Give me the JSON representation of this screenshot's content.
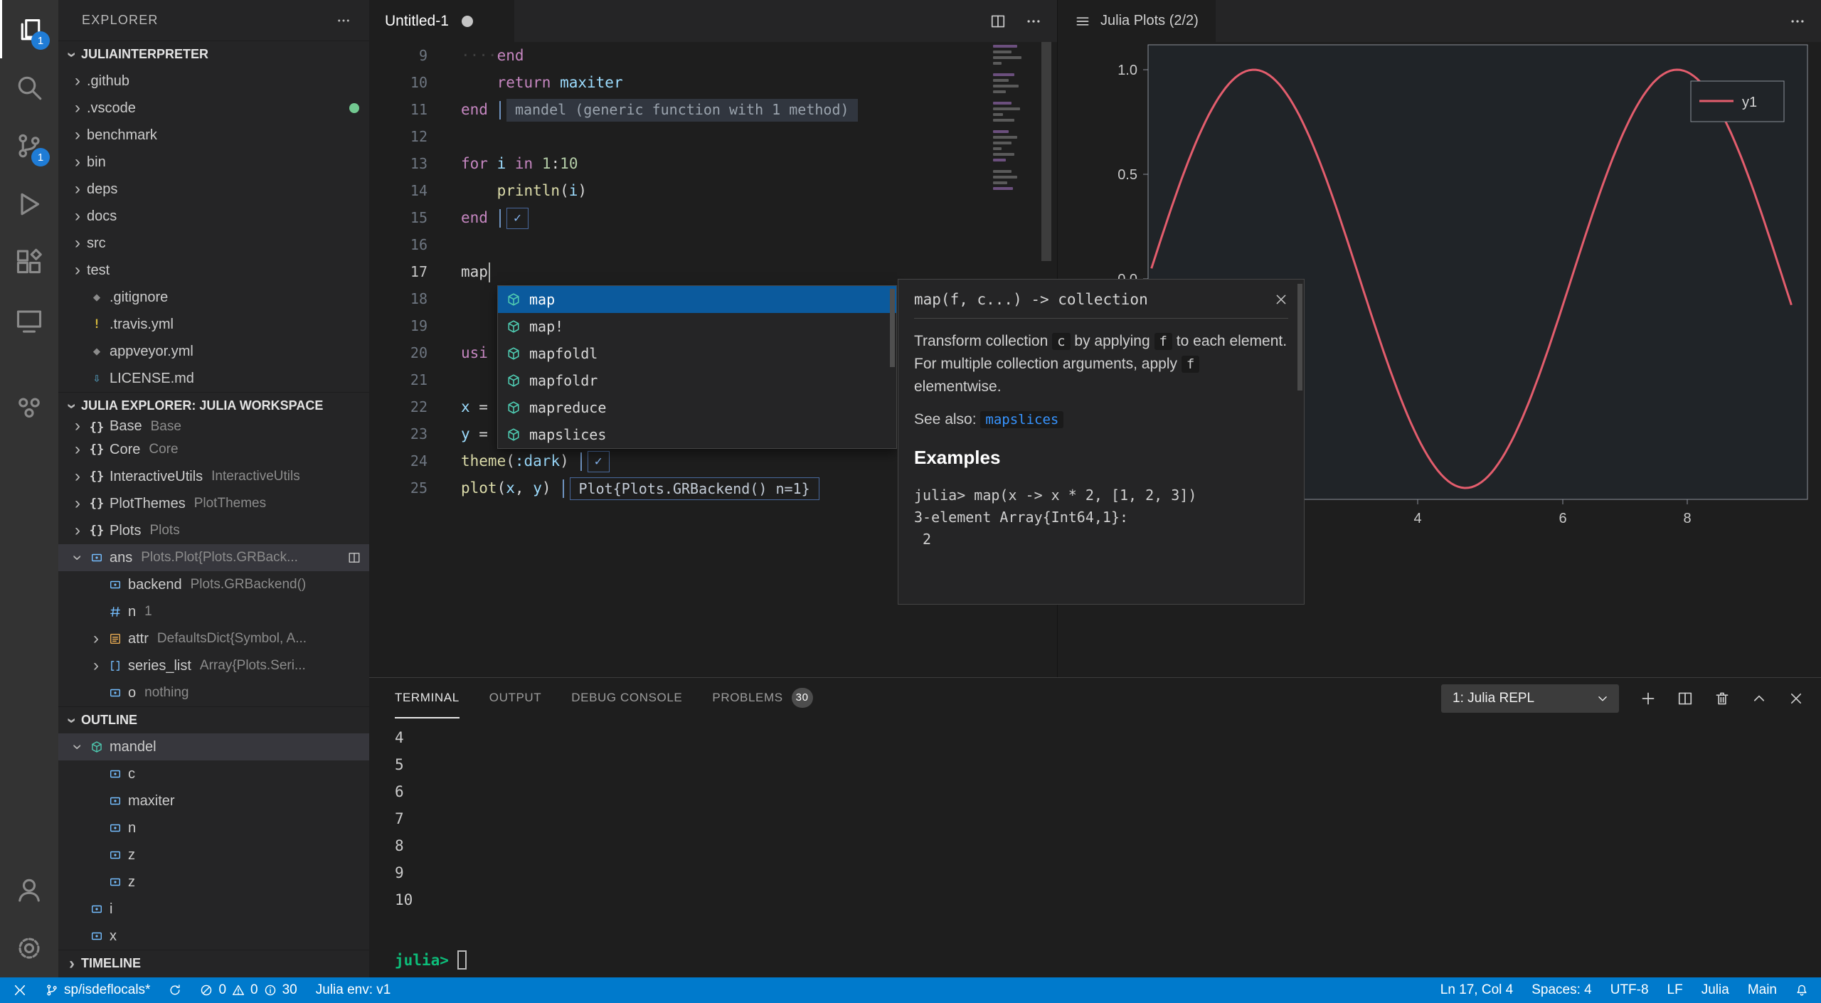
{
  "colors": {
    "status_bar_bg": "#007acc",
    "curve": "#e35d6d",
    "badge_blue": "#1f7cd6",
    "prompt_green": "#0dbc79"
  },
  "activity_bar": {
    "badges": {
      "explorer": "1",
      "scm": "1"
    }
  },
  "sidebar": {
    "title": "EXPLORER",
    "sections": [
      {
        "label": "JULIAINTERPRETER",
        "expanded": true,
        "items": [
          {
            "chev": "right",
            "label": ".github"
          },
          {
            "chev": "right",
            "label": ".vscode",
            "git_dot": true
          },
          {
            "chev": "right",
            "label": "benchmark"
          },
          {
            "chev": "right",
            "label": "bin"
          },
          {
            "chev": "right",
            "label": "deps"
          },
          {
            "chev": "right",
            "label": "docs"
          },
          {
            "chev": "right",
            "label": "src"
          },
          {
            "chev": "right",
            "label": "test"
          },
          {
            "icon": {
              "name": "gitignore-file-icon",
              "text": "◆",
              "color": "#8b8b8b"
            },
            "label": ".gitignore"
          },
          {
            "icon": {
              "name": "travis-file-icon",
              "text": "!",
              "color": "#d7ba3d"
            },
            "label": ".travis.yml"
          },
          {
            "icon": {
              "name": "appveyor-file-icon",
              "text": "◆",
              "color": "#8b8b8b"
            },
            "label": "appveyor.yml"
          },
          {
            "icon": {
              "name": "markdown-file-icon",
              "text": "⇩",
              "color": "#519aba"
            },
            "label": "LICENSE.md"
          }
        ]
      },
      {
        "label": "JULIA EXPLORER: JULIA WORKSPACE",
        "expanded": true,
        "items": [
          {
            "chev": "right",
            "clip": true,
            "icon": {
              "name": "namespace-icon",
              "text": "{}",
              "color": "#d4d4d4"
            },
            "label": "Base",
            "detail": "Base"
          },
          {
            "chev": "right",
            "icon": {
              "name": "namespace-icon",
              "text": "{}",
              "color": "#d4d4d4"
            },
            "label": "Core",
            "detail": "Core"
          },
          {
            "chev": "right",
            "icon": {
              "name": "namespace-icon",
              "text": "{}",
              "color": "#d4d4d4"
            },
            "label": "InteractiveUtils",
            "detail": "InteractiveUtils"
          },
          {
            "chev": "right",
            "icon": {
              "name": "namespace-icon",
              "text": "{}",
              "color": "#d4d4d4"
            },
            "label": "PlotThemes",
            "detail": "PlotThemes"
          },
          {
            "chev": "right",
            "icon": {
              "name": "namespace-icon",
              "text": "{}",
              "color": "#d4d4d4"
            },
            "label": "Plots",
            "detail": "Plots"
          },
          {
            "chev": "down",
            "icon": {
              "name": "variable-icon",
              "svg": "var",
              "color": "#75beff"
            },
            "label": "ans",
            "detail": "Plots.Plot{Plots.GRBack...",
            "selected": true,
            "trailing": true
          },
          {
            "indent": 2,
            "icon": {
              "name": "variable-icon",
              "svg": "var",
              "color": "#75beff"
            },
            "label": "backend",
            "detail": "Plots.GRBackend()"
          },
          {
            "indent": 2,
            "icon": {
              "name": "number-icon",
              "svg": "hash",
              "color": "#75beff"
            },
            "label": "n",
            "detail": "1"
          },
          {
            "indent": 2,
            "chev": "right",
            "icon": {
              "name": "attr-icon",
              "svg": "attr",
              "color": "#e8ab53"
            },
            "label": "attr",
            "detail": "DefaultsDict{Symbol, A..."
          },
          {
            "indent": 2,
            "chev": "right",
            "icon": {
              "name": "array-icon",
              "svg": "list",
              "color": "#75beff"
            },
            "label": "series_list",
            "detail": "Array{Plots.Seri..."
          },
          {
            "indent": 2,
            "icon": {
              "name": "variable-icon",
              "svg": "var",
              "color": "#75beff"
            },
            "label": "o",
            "detail": "nothing"
          }
        ]
      },
      {
        "label": "OUTLINE",
        "expanded": true,
        "items": [
          {
            "chev": "down",
            "icon": {
              "name": "method-icon",
              "svg": "cube",
              "color": "#4ec9b0"
            },
            "label": "mandel",
            "selected": true
          },
          {
            "indent": 2,
            "icon": {
              "name": "variable-icon",
              "svg": "var",
              "color": "#75beff"
            },
            "label": "c"
          },
          {
            "indent": 2,
            "icon": {
              "name": "variable-icon",
              "svg": "var",
              "color": "#75beff"
            },
            "label": "maxiter"
          },
          {
            "indent": 2,
            "icon": {
              "name": "variable-icon",
              "svg": "var",
              "color": "#75beff"
            },
            "label": "n"
          },
          {
            "indent": 2,
            "icon": {
              "name": "variable-icon",
              "svg": "var",
              "color": "#75beff"
            },
            "label": "z"
          },
          {
            "indent": 2,
            "icon": {
              "name": "variable-icon",
              "svg": "var",
              "color": "#75beff"
            },
            "label": "z"
          },
          {
            "icon": {
              "name": "variable-icon",
              "svg": "var",
              "color": "#75beff"
            },
            "label": "i"
          },
          {
            "icon": {
              "name": "variable-icon",
              "svg": "var",
              "color": "#75beff"
            },
            "label": "x"
          }
        ]
      },
      {
        "label": "TIMELINE",
        "expanded": false,
        "items": []
      }
    ]
  },
  "editor": {
    "tab": {
      "title": "Untitled-1",
      "dirty": true
    },
    "lines": [
      {
        "num": 9,
        "segs": [
          {
            "c": "ws",
            "t": "····"
          },
          {
            "c": "kw",
            "t": "end"
          }
        ]
      },
      {
        "num": 10,
        "segs": [
          {
            "c": "p",
            "t": "    "
          },
          {
            "c": "kw",
            "t": "return"
          },
          {
            "c": "p",
            "t": " "
          },
          {
            "c": "v",
            "t": "maxiter"
          }
        ]
      },
      {
        "num": 11,
        "segs": [
          {
            "c": "kw",
            "t": "end"
          }
        ],
        "widgets": [
          {
            "type": "result",
            "text": "mandel (generic function with 1 method)"
          }
        ]
      },
      {
        "num": 12,
        "segs": []
      },
      {
        "num": 13,
        "segs": [
          {
            "c": "kw",
            "t": "for"
          },
          {
            "c": "p",
            "t": " "
          },
          {
            "c": "v",
            "t": "i"
          },
          {
            "c": "p",
            "t": " "
          },
          {
            "c": "kw",
            "t": "in"
          },
          {
            "c": "p",
            "t": " "
          },
          {
            "c": "n",
            "t": "1"
          },
          {
            "c": "p",
            "t": ":"
          },
          {
            "c": "n",
            "t": "10"
          }
        ]
      },
      {
        "num": 14,
        "segs": [
          {
            "c": "p",
            "t": "    "
          },
          {
            "c": "fn",
            "t": "println"
          },
          {
            "c": "p",
            "t": "("
          },
          {
            "c": "v",
            "t": "i"
          },
          {
            "c": "p",
            "t": ")"
          }
        ]
      },
      {
        "num": 15,
        "segs": [
          {
            "c": "kw",
            "t": "end"
          }
        ],
        "widgets": [
          {
            "type": "check"
          }
        ]
      },
      {
        "num": 16,
        "segs": []
      },
      {
        "num": 17,
        "active": true,
        "cursor": true,
        "segs": [
          {
            "c": "p",
            "t": "map"
          }
        ]
      },
      {
        "num": 18,
        "segs": []
      },
      {
        "num": 19,
        "segs": []
      },
      {
        "num": 20,
        "segs": [
          {
            "c": "kw",
            "t": "usi"
          }
        ]
      },
      {
        "num": 21,
        "segs": []
      },
      {
        "num": 22,
        "segs": [
          {
            "c": "v",
            "t": "x"
          },
          {
            "c": "p",
            "t": " ="
          }
        ]
      },
      {
        "num": 23,
        "segs": [
          {
            "c": "v",
            "t": "y"
          },
          {
            "c": "p",
            "t": " ="
          }
        ]
      },
      {
        "num": 24,
        "segs": [
          {
            "c": "fn",
            "t": "theme"
          },
          {
            "c": "p",
            "t": "("
          },
          {
            "c": "v",
            "t": ":dark"
          },
          {
            "c": "p",
            "t": ")"
          }
        ],
        "widgets": [
          {
            "type": "check"
          }
        ]
      },
      {
        "num": 25,
        "segs": [
          {
            "c": "fn",
            "t": "plot"
          },
          {
            "c": "p",
            "t": "("
          },
          {
            "c": "v",
            "t": "x"
          },
          {
            "c": "p",
            "t": ", "
          },
          {
            "c": "v",
            "t": "y"
          },
          {
            "c": "p",
            "t": ")"
          }
        ],
        "widgets": [
          {
            "type": "result",
            "boxed": true,
            "text": "Plot{Plots.GRBackend() n=1}"
          }
        ]
      }
    ],
    "suggest": {
      "items": [
        {
          "label": "map",
          "selected": true
        },
        {
          "label": "map!"
        },
        {
          "label": "mapfoldl"
        },
        {
          "label": "mapfoldr"
        },
        {
          "label": "mapreduce"
        },
        {
          "label": "mapslices"
        }
      ]
    },
    "doc_popup": {
      "title": "map(f, c...) -> collection",
      "body": [
        {
          "t": "Transform collection "
        },
        {
          "t": "c",
          "chip": true
        },
        {
          "t": " by applying "
        },
        {
          "t": "f",
          "chip": true
        },
        {
          "t": " to each element. For multiple collection arguments, apply "
        },
        {
          "t": "f",
          "chip": true
        },
        {
          "t": " elementwise."
        }
      ],
      "see_also_label": "See also:",
      "see_also_link": "mapslices",
      "examples_heading": "Examples",
      "code_lines": [
        "julia> map(x -> x * 2, [1, 2, 3])",
        "3-element Array{Int64,1}:",
        " 2"
      ]
    }
  },
  "plots": {
    "tab": "Julia Plots (2/2)",
    "chart_data": {
      "type": "line",
      "series": [
        {
          "name": "y1",
          "formula": "sin(x)"
        }
      ],
      "x_range": [
        0.05,
        9.55
      ],
      "ylim": [
        -1,
        1
      ],
      "x_ticks": [
        "4",
        "6",
        "8"
      ],
      "y_ticks": [
        "1.0",
        "0.5",
        "0.0"
      ],
      "legend": {
        "entries": [
          "y1"
        ],
        "position": "top-right"
      },
      "color": "#e35d6d",
      "grid": false
    }
  },
  "panel": {
    "tabs": [
      {
        "label": "TERMINAL",
        "active": true
      },
      {
        "label": "OUTPUT"
      },
      {
        "label": "DEBUG CONSOLE"
      },
      {
        "label": "PROBLEMS",
        "badge": "30"
      }
    ],
    "repl_select": "1: Julia REPL",
    "terminal": {
      "lines": [
        "4",
        "5",
        "6",
        "7",
        "8",
        "9",
        "10",
        ""
      ],
      "prompt": "julia>"
    }
  },
  "status_bar": {
    "branch": "sp/isdeflocals*",
    "errors": "0",
    "warnings": "0",
    "infos": "30",
    "julia_env": "Julia env: v1",
    "line_col": "Ln 17, Col 4",
    "spaces": "Spaces: 4",
    "encoding": "UTF-8",
    "eol": "LF",
    "language": "Julia",
    "main": "Main"
  }
}
